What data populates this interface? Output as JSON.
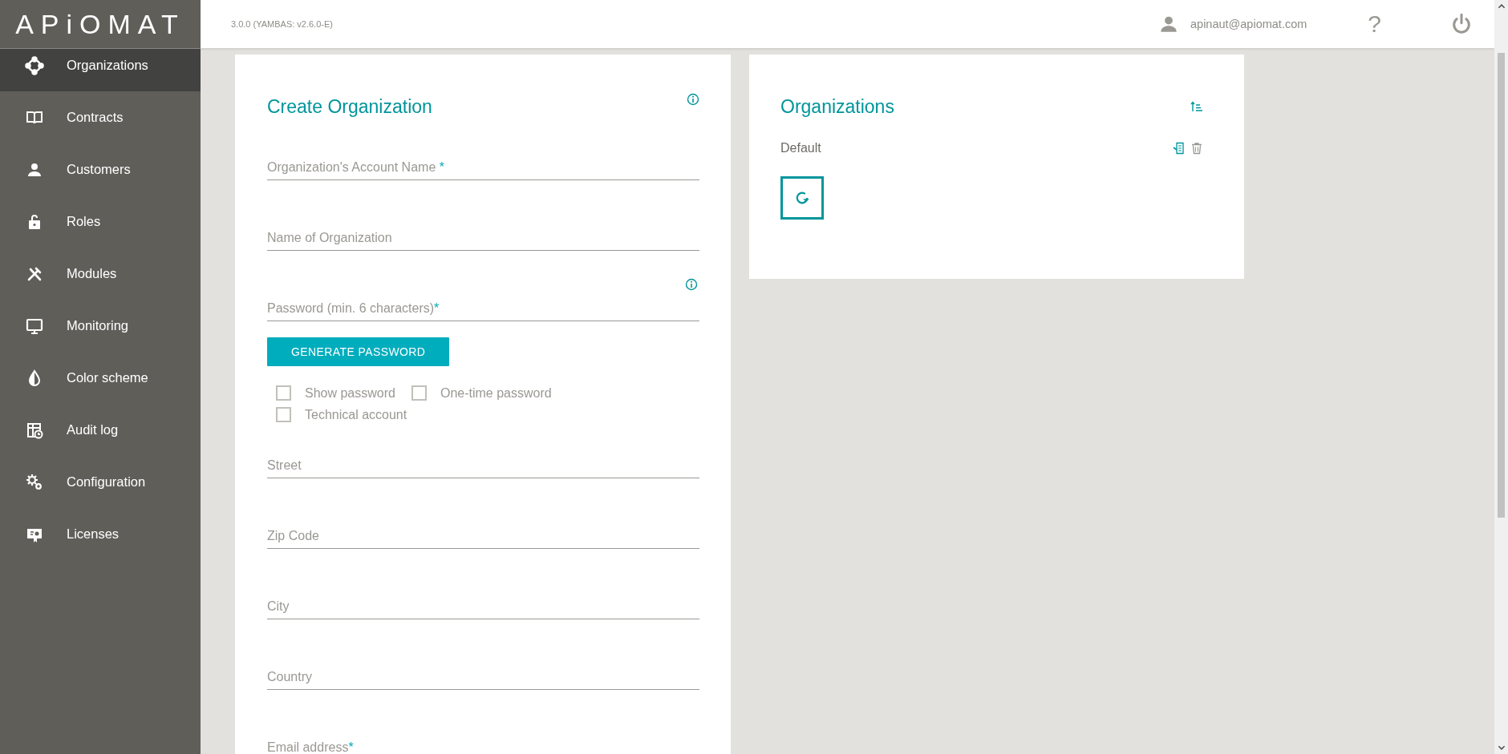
{
  "logo": "APiOMAT",
  "header": {
    "version": "3.0.0 (YAMBAS: v2.6.0-E)",
    "user": "apinaut@apiomat.com",
    "help": "?"
  },
  "sidebar": {
    "items": [
      {
        "label": "Organizations",
        "kind": "org",
        "selected": true
      },
      {
        "label": "Contracts",
        "kind": "book",
        "selected": false
      },
      {
        "label": "Customers",
        "kind": "person",
        "selected": false
      },
      {
        "label": "Roles",
        "kind": "lock",
        "selected": false
      },
      {
        "label": "Modules",
        "kind": "tools",
        "selected": false
      },
      {
        "label": "Monitoring",
        "kind": "monitor",
        "selected": false
      },
      {
        "label": "Color scheme",
        "kind": "drop",
        "selected": false
      },
      {
        "label": "Audit log",
        "kind": "audit",
        "selected": false
      },
      {
        "label": "Configuration",
        "kind": "gears",
        "selected": false
      },
      {
        "label": "Licenses",
        "kind": "license",
        "selected": false
      }
    ]
  },
  "create_form": {
    "title": "Create Organization",
    "fields": [
      {
        "placeholder": "Organization's Account Name",
        "required_mark": " *",
        "info": false
      },
      {
        "placeholder": "Name of Organization",
        "info": false
      },
      {
        "placeholder": "Password (min. 6 characters)",
        "required_mark": "*",
        "info": true
      },
      {
        "placeholder": "Street",
        "info": false
      },
      {
        "placeholder": "Zip Code",
        "info": false
      },
      {
        "placeholder": "City",
        "info": false
      },
      {
        "placeholder": "Country",
        "info": false
      },
      {
        "placeholder": "Email address",
        "required_mark": "*",
        "info": false
      }
    ],
    "generate_button": "GENERATE PASSWORD",
    "checkboxes": [
      {
        "label": "Show password",
        "checked": false
      },
      {
        "label": "One-time password",
        "checked": false
      },
      {
        "label": "Technical account",
        "checked": false
      }
    ]
  },
  "organizations": {
    "title": "Organizations",
    "items": [
      {
        "name": "Default"
      }
    ]
  }
}
